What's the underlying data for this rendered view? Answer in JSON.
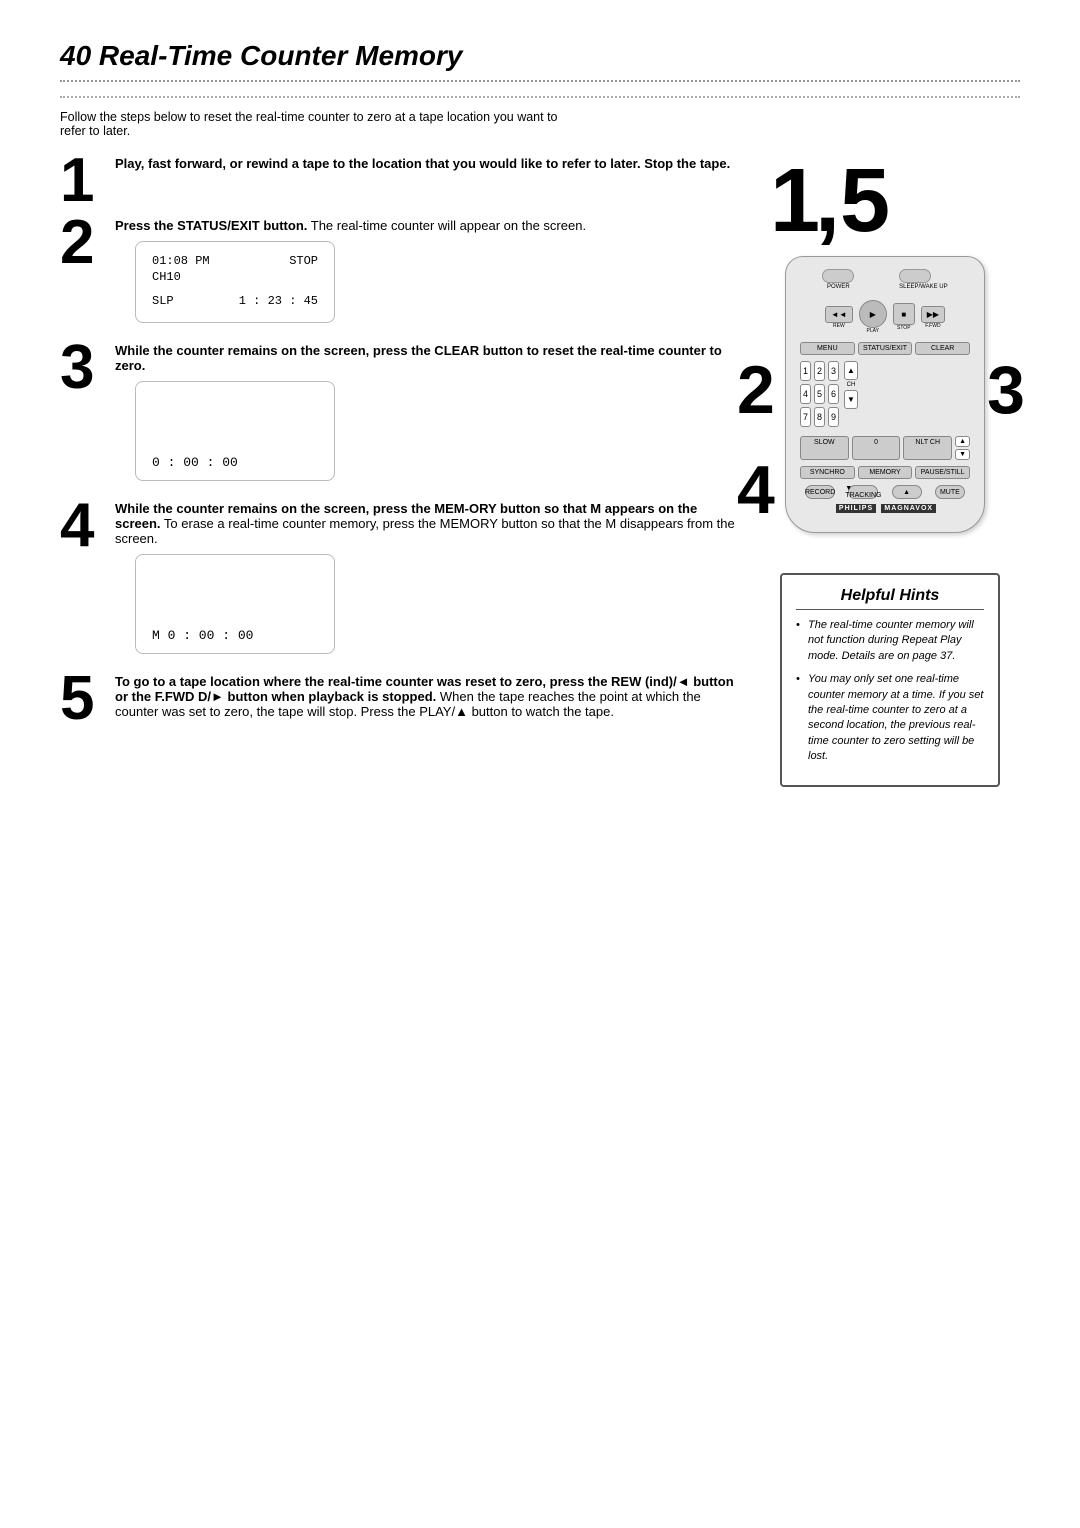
{
  "page": {
    "title": "40  Real-Time Counter Memory",
    "intro": "Follow the steps below to reset the real-time counter to zero at a tape location you want to refer to later."
  },
  "steps": [
    {
      "number": "1",
      "instruction_bold": "Play, fast forward, or rewind a tape to the location that you would like to refer to later.  Stop the tape.",
      "instruction_normal": ""
    },
    {
      "number": "2",
      "instruction_bold": "Press the STATUS/EXIT button.",
      "instruction_normal": "  The real-time counter will appear on the screen.",
      "screen": {
        "line1_left": "01:08 PM",
        "line1_right": "STOP",
        "line2_left": "CH10",
        "line2_right": "",
        "spacer": "",
        "line3_left": "SLP",
        "line3_right": "1 : 23 : 45"
      }
    },
    {
      "number": "3",
      "instruction_bold": "While the counter remains on the screen, press the CLEAR button to reset the real-time counter to zero.",
      "instruction_normal": "",
      "screen": {
        "counter": "0 : 00 : 00"
      }
    },
    {
      "number": "4",
      "instruction_bold": "While the counter remains on the screen, press the MEM-ORY button so that M appears on the screen.",
      "instruction_normal": "  To erase a real-time counter memory, press the MEMORY button so that the M disappears from the screen.",
      "screen": {
        "counter": "M  0 : 00 : 00"
      }
    },
    {
      "number": "5",
      "instruction_bold": "To go to a tape location where the real-time counter was reset to zero, press the REW (ind)/◄ button or the F.FWD D/► button when playback is stopped.",
      "instruction_normal": "  When the tape reaches the point at which the counter was set to zero, the tape will stop.  Press the PLAY/▲ button to watch the tape."
    }
  ],
  "helpful_hints": {
    "title": "Helpful Hints",
    "items": [
      "The real-time counter memory will not function during Repeat Play mode.  Details are on page 37.",
      "You may only set one real-time counter memory at a time. If you set the real-time counter to zero at a second location, the previous real-time counter to zero setting will be lost."
    ]
  },
  "remote": {
    "labels": {
      "power": "POWER",
      "sleep": "SLEEP/WAKE UP",
      "rew": "REW",
      "play": "PLAY",
      "fwd": "F.FWD",
      "stop": "STOP",
      "menu": "MENU",
      "status": "STATUS/EXIT",
      "clear": "CLEAR",
      "slow": "SLOW",
      "zero": "0",
      "nlt_ch": "NLT CH",
      "synchro": "SYNCHRO",
      "memory": "MEMORY",
      "pause": "PAUSE/STILL",
      "record": "RECORD",
      "tracking_down": "▼ TRACKING",
      "tracking_up": "▲",
      "mute": "MUTE",
      "brand": "PHILIPS",
      "brand2": "MAGNAVOX",
      "nums": [
        "1",
        "2",
        "3",
        "4",
        "5",
        "6",
        "7",
        "8",
        "9"
      ]
    }
  },
  "big_numbers": "1,5",
  "side_numbers_left": [
    "2",
    "4"
  ],
  "side_numbers_right": [
    "3"
  ]
}
